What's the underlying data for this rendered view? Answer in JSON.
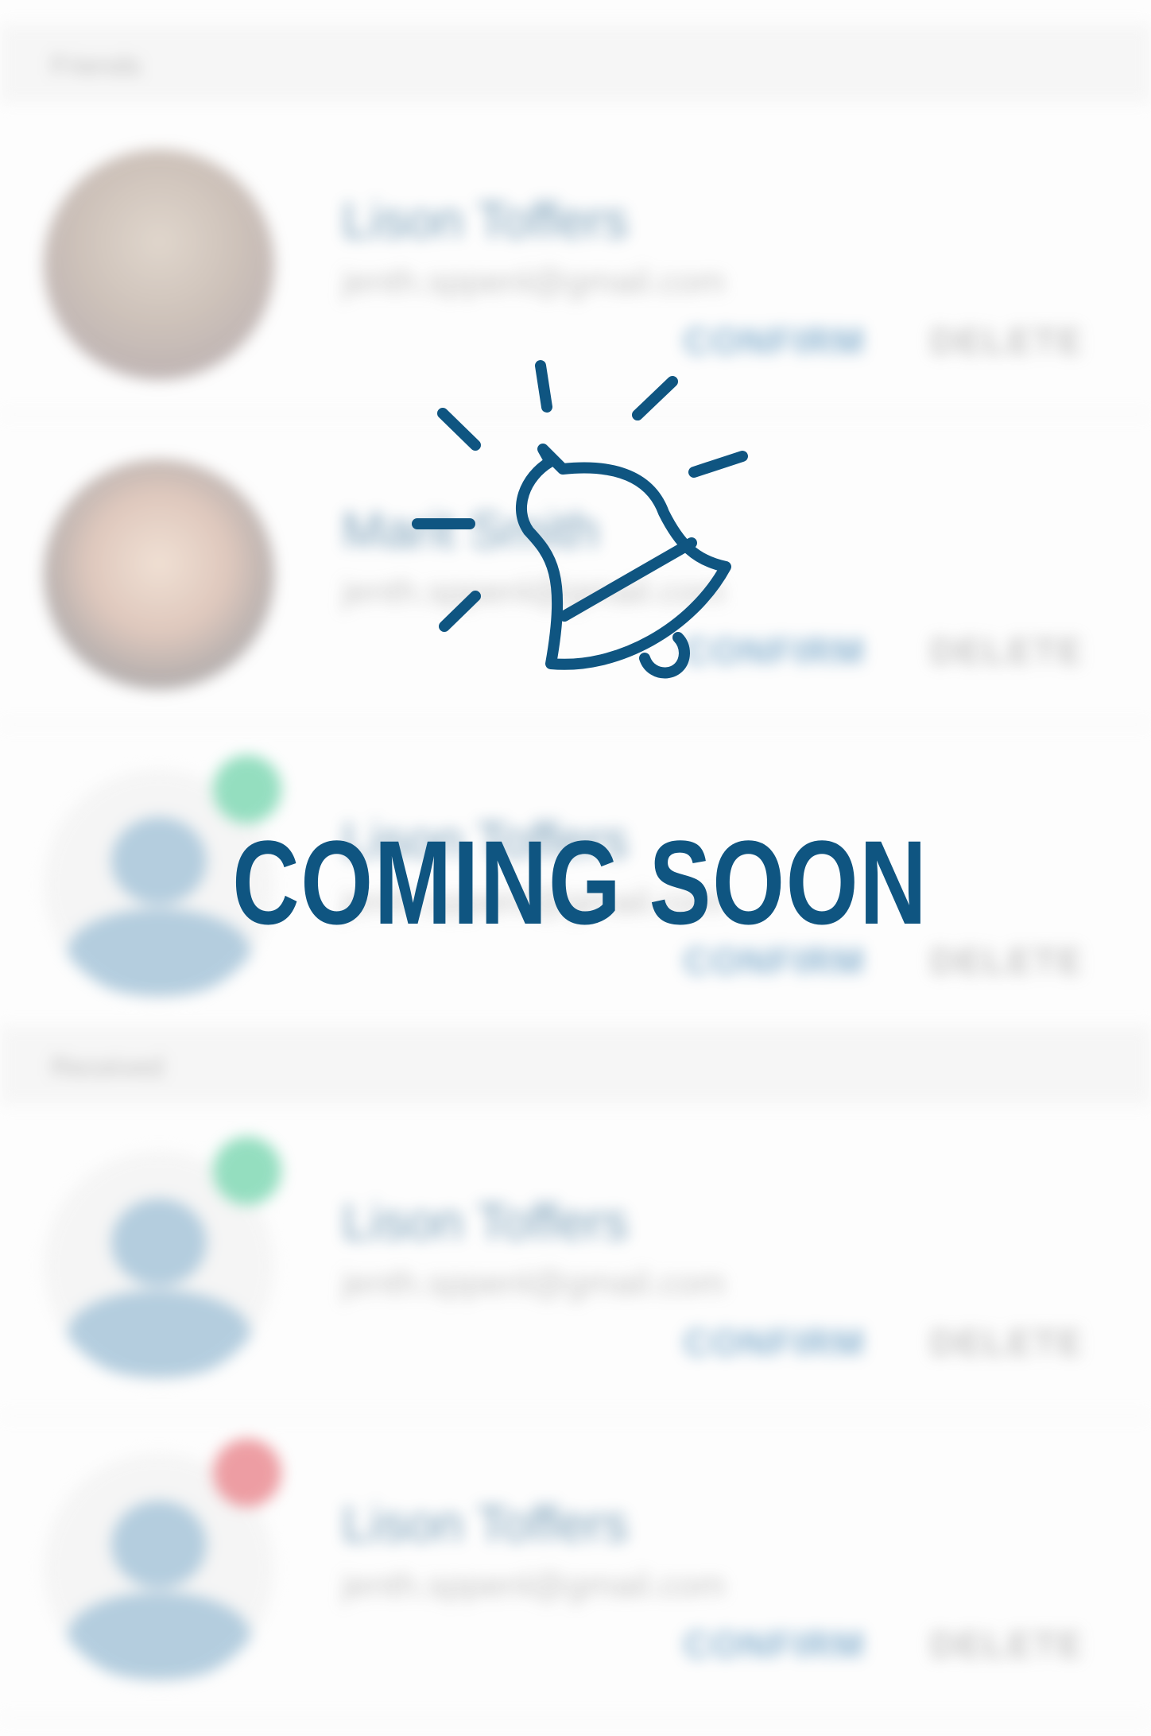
{
  "overlay": {
    "message": "COMING SOON",
    "icon": "bell-ringing-icon",
    "color": "#0f5581"
  },
  "sections": [
    {
      "header": "Friends",
      "rows": [
        {
          "name": "Lison Toffers",
          "email": "jenth.sppenl@gmail.com",
          "avatar": "photo-female",
          "badge": null,
          "confirm": "CONFIRM",
          "delete": "DELETE"
        },
        {
          "name": "Marit Smith",
          "email": "jenth.sppenl@gmail.com",
          "avatar": "photo-male",
          "badge": null,
          "confirm": "CONFIRM",
          "delete": "DELETE"
        },
        {
          "name": "Lison Toffers",
          "email": "jenth.sppenl@gmail.com",
          "avatar": "placeholder",
          "badge": "accepted",
          "confirm": "CONFIRM",
          "delete": "DELETE"
        }
      ]
    },
    {
      "header": "Received",
      "rows": [
        {
          "name": "Lison Toffers",
          "email": "jenth.sppenl@gmail.com",
          "avatar": "placeholder",
          "badge": "accepted",
          "confirm": "CONFIRM",
          "delete": "DELETE"
        },
        {
          "name": "Lison Toffers",
          "email": "jenth.sppenl@gmail.com",
          "avatar": "placeholder",
          "badge": "declined",
          "confirm": "CONFIRM",
          "delete": "DELETE"
        }
      ]
    }
  ],
  "colors": {
    "accent": "#1a5a86",
    "accepted": "#3fc58e",
    "declined": "#e0505a",
    "placeholder_avatar": "#79a7c6"
  }
}
